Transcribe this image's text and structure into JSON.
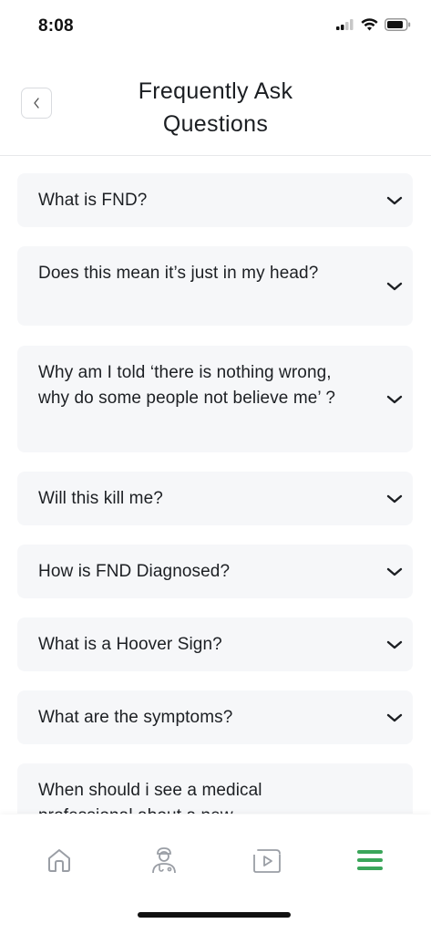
{
  "status_bar": {
    "time": "8:08"
  },
  "header": {
    "title_line1": "Frequently Ask",
    "title_line2": "Questions"
  },
  "faq": {
    "items": [
      {
        "question": "What is FND?"
      },
      {
        "question": "Does this mean it’s just in my head?"
      },
      {
        "question": "Why am I told ‘there is nothing wrong, why do some people not believe me’ ?"
      },
      {
        "question": "Will this kill me?"
      },
      {
        "question": "How is FND Diagnosed?"
      },
      {
        "question": "What is a Hoover Sign?"
      },
      {
        "question": "What are the symptoms?"
      },
      {
        "question": "When should i see a medical professional about a new"
      }
    ]
  },
  "bottom_nav": {
    "items": [
      {
        "icon": "home-icon",
        "active": false
      },
      {
        "icon": "doctor-icon",
        "active": false
      },
      {
        "icon": "video-play-icon",
        "active": false
      },
      {
        "icon": "menu-icon",
        "active": true
      }
    ]
  },
  "colors": {
    "accent": "#3aa65a",
    "card_bg": "#f6f7f9",
    "inactive_icon": "#9a9ea5"
  }
}
